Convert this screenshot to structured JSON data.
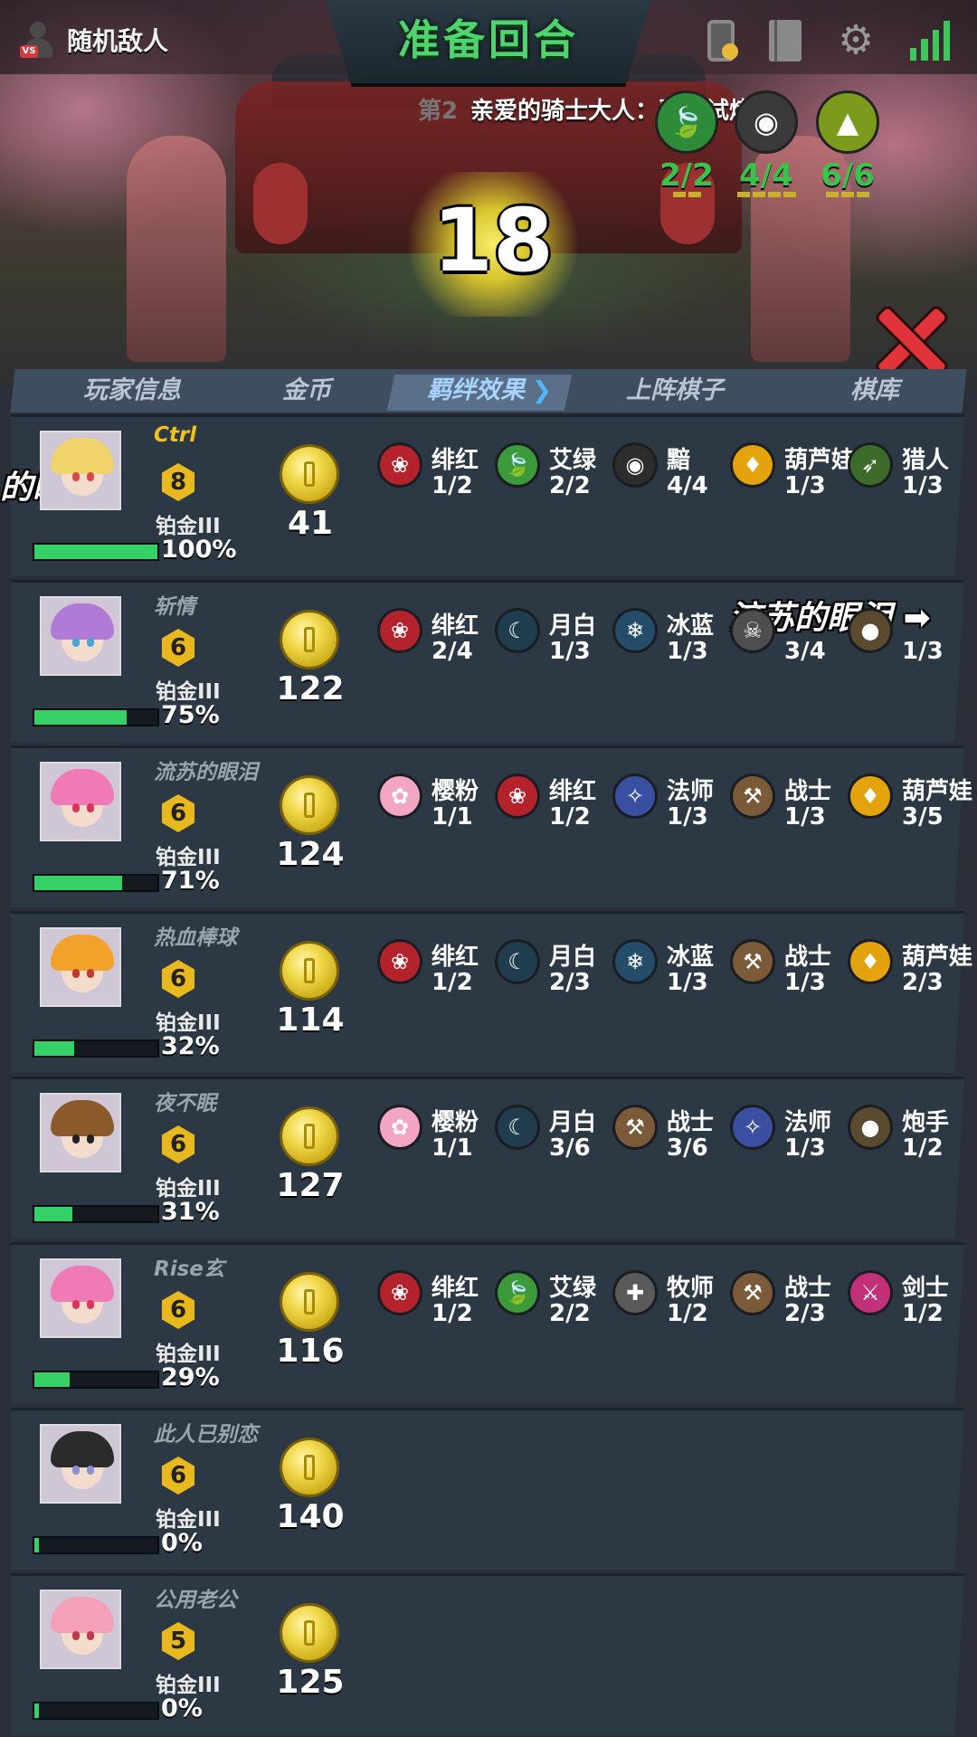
{
  "topbar": {
    "enemy_label": "随机敌人",
    "phase_title": "准备回合"
  },
  "announcement": {
    "round_prefix": "第2",
    "message": "亲爱的骑士大人：骑士试炼"
  },
  "top_traits": [
    {
      "icon": "leaf-icon",
      "color": "#2e8b3a",
      "count": "2/2"
    },
    {
      "icon": "eye-icon",
      "color": "#3a3a3a",
      "count": "4/4"
    },
    {
      "icon": "hood-icon",
      "color": "#7c9a1c",
      "count": "6/6"
    }
  ],
  "timer": "18",
  "tabs": [
    "玩家信息",
    "金币",
    "羁绊效果",
    "上阵棋子",
    "棋库"
  ],
  "players": [
    {
      "name": "Ctrl",
      "level": "8",
      "rank": "铂金III",
      "hp_pct": 100,
      "hp_text": "100%",
      "gold": "41",
      "hair": "#f0d36a",
      "eye": "#d94848",
      "traits": [
        [
          "绯红",
          "1/2",
          "rose-icon",
          "#b4232b"
        ],
        [
          "艾绿",
          "2/2",
          "leaf-icon",
          "#3c9a3a"
        ],
        [
          "黯",
          "4/4",
          "eye-icon",
          "#2d2d2d"
        ],
        [
          "葫芦娃",
          "1/3",
          "gourd-icon",
          "#e4a20c"
        ],
        [
          "猎人",
          "1/3",
          "bow-icon",
          "#3d6b2a"
        ]
      ]
    },
    {
      "name": "斩情",
      "level": "6",
      "rank": "铂金III",
      "hp_pct": 75,
      "hp_text": "75%",
      "gold": "122",
      "hair": "#b07ad6",
      "eye": "#4aa3d9",
      "traits": [
        [
          "绯红",
          "2/4",
          "rose-icon",
          "#b4232b"
        ],
        [
          "月白",
          "1/3",
          "moon-icon",
          "#1f3d4f"
        ],
        [
          "冰蓝",
          "1/3",
          "snowflake-icon",
          "#244d6a"
        ],
        [
          "",
          "3/4",
          "skull-icon",
          "#4e4e4e"
        ],
        [
          "",
          "1/3",
          "cannon-icon",
          "#5a4a30"
        ]
      ]
    },
    {
      "name": "流苏的眼泪",
      "level": "6",
      "rank": "铂金III",
      "hp_pct": 71,
      "hp_text": "71%",
      "gold": "124",
      "hair": "#f07ab5",
      "eye": "#d9345a",
      "traits": [
        [
          "樱粉",
          "1/1",
          "blossom-icon",
          "#f3a6c4"
        ],
        [
          "绯红",
          "1/2",
          "rose-icon",
          "#b4232b"
        ],
        [
          "法师",
          "1/3",
          "mage-icon",
          "#3a4fa0"
        ],
        [
          "战士",
          "1/3",
          "axe-icon",
          "#7a5a38"
        ],
        [
          "葫芦娃",
          "3/5",
          "gourd-icon",
          "#e4a20c"
        ]
      ]
    },
    {
      "name": "热血棒球",
      "level": "6",
      "rank": "铂金III",
      "hp_pct": 32,
      "hp_text": "32%",
      "gold": "114",
      "hair": "#f2a22a",
      "eye": "#c0392b",
      "traits": [
        [
          "绯红",
          "1/2",
          "rose-icon",
          "#b4232b"
        ],
        [
          "月白",
          "2/3",
          "moon-icon",
          "#1f3d4f"
        ],
        [
          "冰蓝",
          "1/3",
          "snowflake-icon",
          "#244d6a"
        ],
        [
          "战士",
          "1/3",
          "axe-icon",
          "#7a5a38"
        ],
        [
          "葫芦娃",
          "2/3",
          "gourd-icon",
          "#e4a20c"
        ]
      ]
    },
    {
      "name": "夜不眠",
      "level": "6",
      "rank": "铂金III",
      "hp_pct": 31,
      "hp_text": "31%",
      "gold": "127",
      "hair": "#8a5a2b",
      "eye": "#222222",
      "traits": [
        [
          "樱粉",
          "1/1",
          "blossom-icon",
          "#f3a6c4"
        ],
        [
          "月白",
          "3/6",
          "moon-icon",
          "#1f3d4f"
        ],
        [
          "战士",
          "3/6",
          "axe-icon",
          "#7a5a38"
        ],
        [
          "法师",
          "1/3",
          "mage-icon",
          "#3a4fa0"
        ],
        [
          "炮手",
          "1/2",
          "cannon-icon",
          "#5a4a30"
        ]
      ]
    },
    {
      "name": "Rise玄",
      "level": "6",
      "rank": "铂金III",
      "hp_pct": 29,
      "hp_text": "29%",
      "gold": "116",
      "hair": "#f07ab5",
      "eye": "#d9345a",
      "traits": [
        [
          "绯红",
          "1/2",
          "rose-icon",
          "#b4232b"
        ],
        [
          "艾绿",
          "2/2",
          "leaf-icon",
          "#3c9a3a"
        ],
        [
          "牧师",
          "1/2",
          "cross-icon",
          "#5a5a5a"
        ],
        [
          "战士",
          "2/3",
          "axe-icon",
          "#7a5a38"
        ],
        [
          "剑士",
          "1/2",
          "sword-icon",
          "#c2307a"
        ]
      ]
    },
    {
      "name": "此人已别恋",
      "level": "6",
      "rank": "铂金III",
      "hp_pct": 0,
      "hp_text": "0%",
      "gold": "140",
      "hair": "#2b2b2b",
      "eye": "#8a8fd0",
      "traits": []
    },
    {
      "name": "公用老公",
      "level": "5",
      "rank": "铂金III",
      "hp_pct": 0,
      "hp_text": "0%",
      "gold": "125",
      "hair": "#f3a0b8",
      "eye": "#c0394f",
      "traits": []
    }
  ],
  "danmaku": [
    {
      "text": "的眼泪",
      "id": "left"
    },
    {
      "text": "流苏的眼泪",
      "id": "right"
    }
  ]
}
